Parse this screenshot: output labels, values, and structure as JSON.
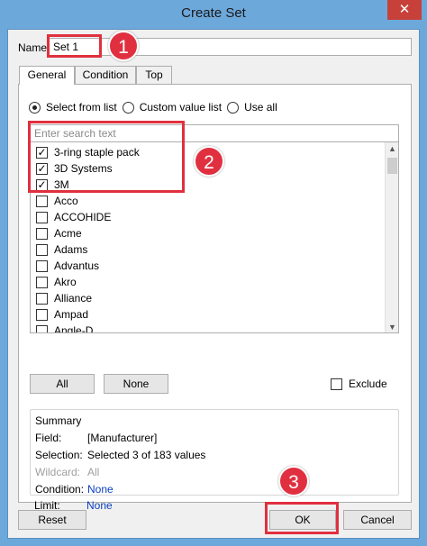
{
  "window": {
    "title": "Create Set",
    "close_glyph": "✕"
  },
  "name": {
    "label": "Name:",
    "value": "Set 1"
  },
  "tabs": [
    {
      "label": "General",
      "active": true
    },
    {
      "label": "Condition",
      "active": false
    },
    {
      "label": "Top",
      "active": false
    }
  ],
  "radios": [
    {
      "label": "Select from list",
      "selected": true
    },
    {
      "label": "Custom value list",
      "selected": false
    },
    {
      "label": "Use all",
      "selected": false
    }
  ],
  "search": {
    "placeholder": "Enter search text"
  },
  "list_items": [
    {
      "label": "3-ring staple pack",
      "checked": true
    },
    {
      "label": "3D Systems",
      "checked": true
    },
    {
      "label": "3M",
      "checked": true
    },
    {
      "label": "Acco",
      "checked": false
    },
    {
      "label": "ACCOHIDE",
      "checked": false
    },
    {
      "label": "Acme",
      "checked": false
    },
    {
      "label": "Adams",
      "checked": false
    },
    {
      "label": "Advantus",
      "checked": false
    },
    {
      "label": "Akro",
      "checked": false
    },
    {
      "label": "Alliance",
      "checked": false
    },
    {
      "label": "Ampad",
      "checked": false
    },
    {
      "label": "Angle-D",
      "checked": false
    }
  ],
  "list_buttons": {
    "all": "All",
    "none": "None"
  },
  "exclude": {
    "label": "Exclude",
    "checked": false
  },
  "summary": {
    "title": "Summary",
    "field_label": "Field:",
    "field_value": "[Manufacturer]",
    "selection_label": "Selection:",
    "selection_value": "Selected 3 of 183 values",
    "wildcard_label": "Wildcard:",
    "wildcard_value": "All",
    "condition_label": "Condition:",
    "condition_value": "None",
    "limit_label": "Limit:",
    "limit_value": "None"
  },
  "footer": {
    "reset": "Reset",
    "ok": "OK",
    "cancel": "Cancel"
  },
  "annotations": [
    "1",
    "2",
    "3"
  ],
  "colors": {
    "annotation": "#e03040",
    "link_blue": "#0a3fbf",
    "titlebar": "#6da8db"
  }
}
